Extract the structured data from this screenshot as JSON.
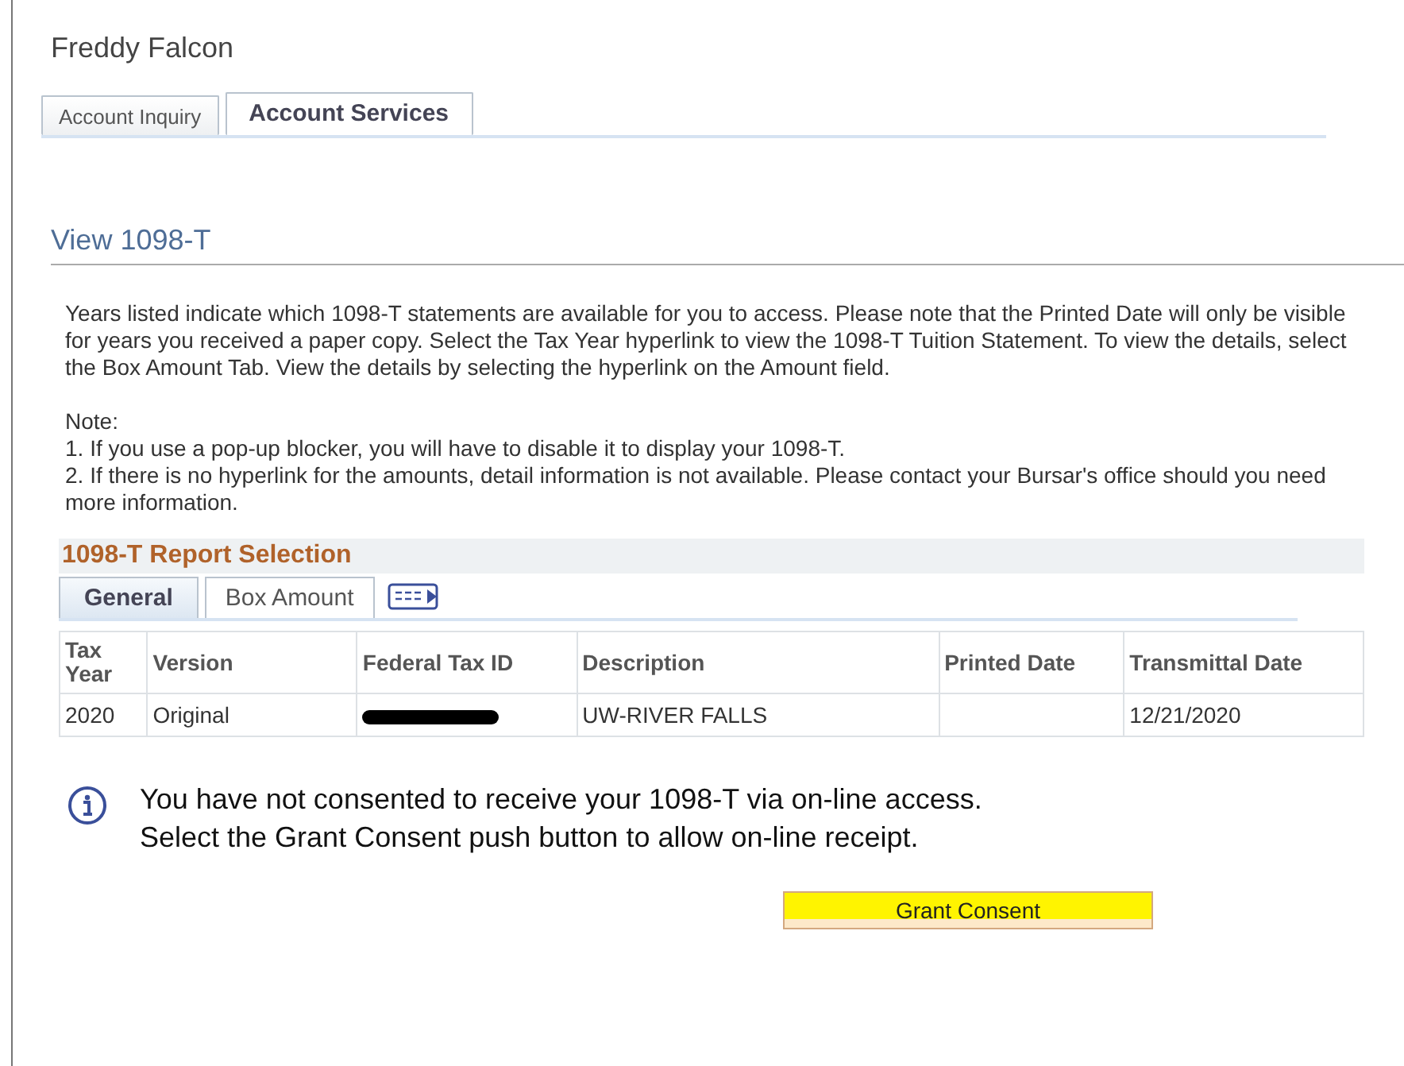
{
  "user_name": "Freddy Falcon",
  "tabs": [
    {
      "label": "Account Inquiry",
      "selected": false
    },
    {
      "label": "Account Services",
      "selected": true
    }
  ],
  "page_title": "View 1098-T",
  "instructions": "Years listed indicate which 1098-T statements are available for you to access.  Please note that the Printed Date will only be visible for years you received a paper copy.  Select the Tax Year hyperlink to view the 1098-T Tuition Statement.  To view the details, select the Box Amount Tab.  View the details by selecting the hyperlink on the Amount field.",
  "note_label": "Note:",
  "notes": [
    "1.  If you use a pop-up blocker, you will have to disable it to display your 1098-T.",
    "2.  If there is no hyperlink for the amounts, detail information is not available.  Please contact your Bursar's office should you need more information."
  ],
  "report": {
    "title": "1098-T Report Selection",
    "tabs": [
      {
        "label": "General",
        "selected": true
      },
      {
        "label": "Box Amount",
        "selected": false
      }
    ],
    "columns": [
      "Tax Year",
      "Version",
      "Federal Tax ID",
      "Description",
      "Printed Date",
      "Transmittal Date"
    ],
    "rows": [
      {
        "tax_year": "2020",
        "version": "Original",
        "federal_tax_id_redacted": true,
        "description": "UW-RIVER FALLS",
        "printed_date": "",
        "transmittal_date": "12/21/2020"
      }
    ]
  },
  "message": [
    "You have not consented to receive your 1098-T via on-line access.",
    "Select the Grant Consent push button to allow on-line receipt."
  ],
  "button": {
    "label": "Grant Consent",
    "highlighted": true
  }
}
